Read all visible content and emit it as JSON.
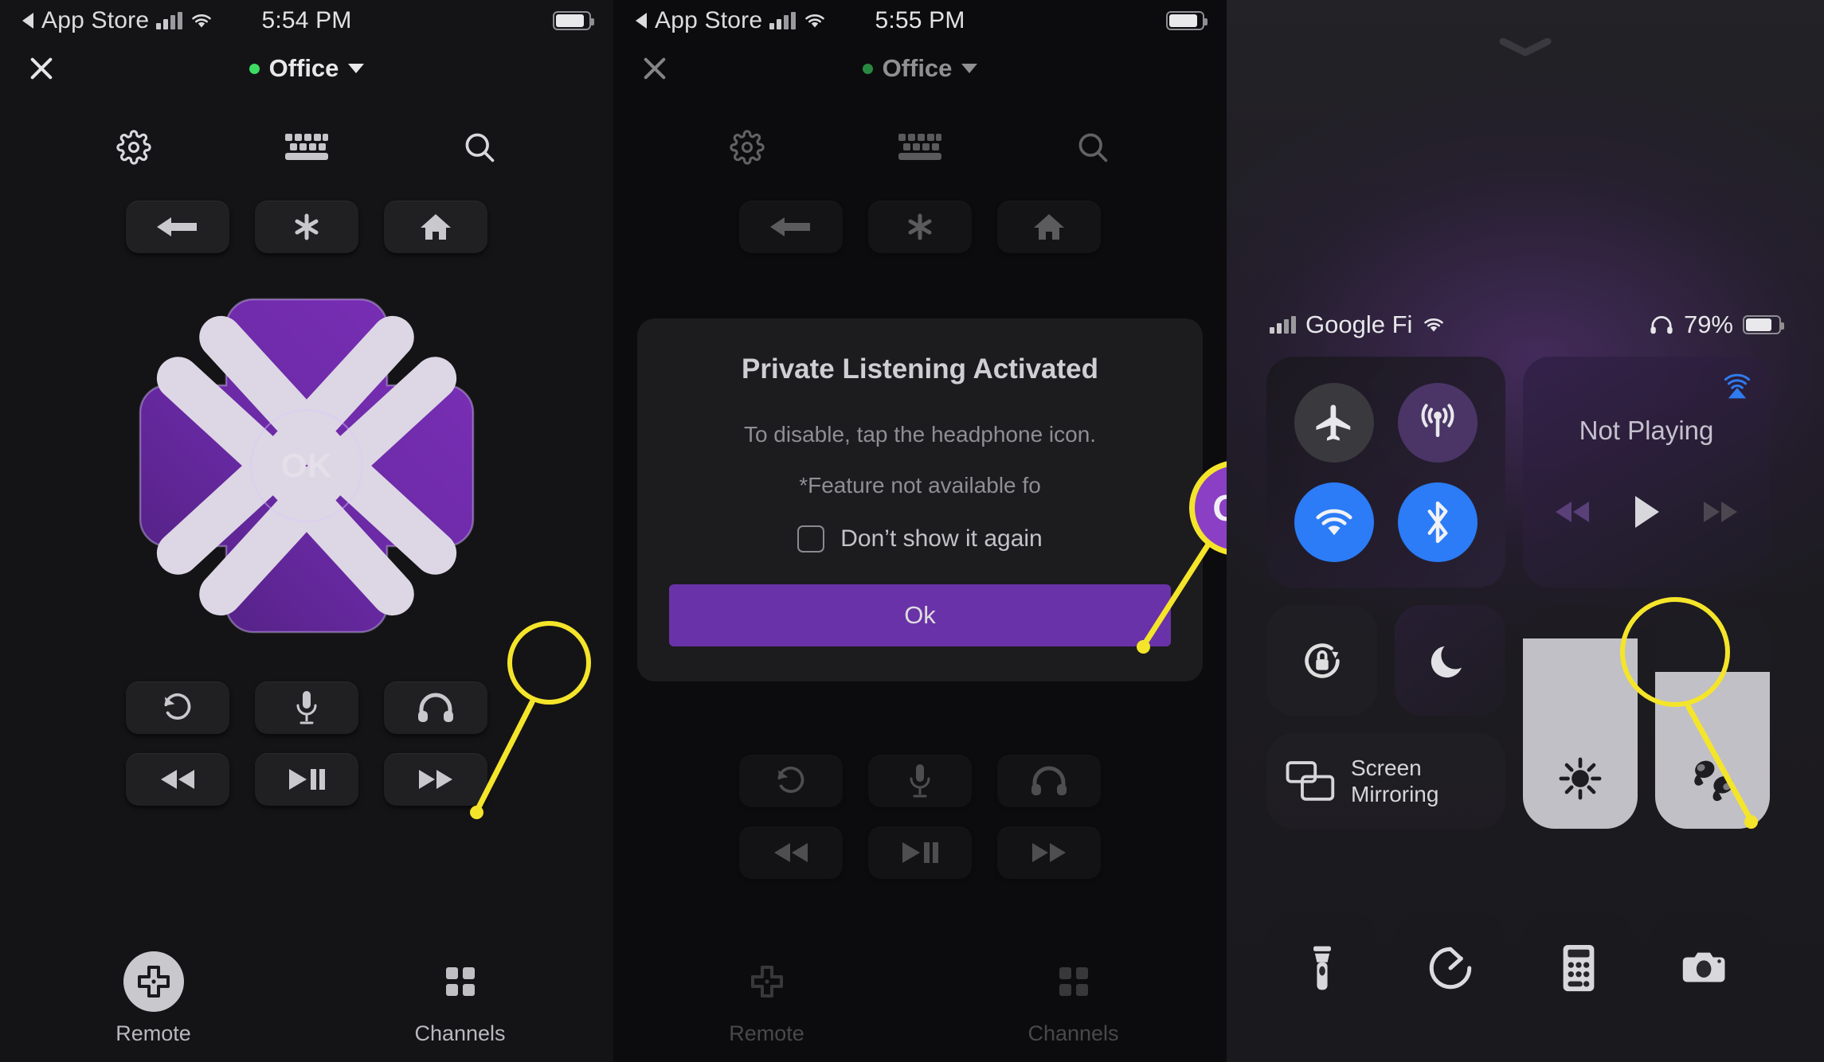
{
  "panel1": {
    "status": {
      "back_app": "App Store",
      "time": "5:54 PM",
      "signal": "signal-bars",
      "wifi": "wifi-icon"
    },
    "header": {
      "close": "close-icon",
      "device": "Office",
      "status_dot": "online"
    },
    "icon_row": [
      {
        "name": "settings-icon",
        "label": "Settings"
      },
      {
        "name": "keyboard-icon",
        "label": "Keyboard"
      },
      {
        "name": "search-icon",
        "label": "Search"
      }
    ],
    "nav": [
      {
        "name": "back-button",
        "label": "Back"
      },
      {
        "name": "options-button",
        "label": "Options"
      },
      {
        "name": "home-button",
        "label": "Home"
      }
    ],
    "dpad": {
      "ok": "OK",
      "up": "Up",
      "down": "Down",
      "left": "Left",
      "right": "Right"
    },
    "media": [
      {
        "name": "replay-button",
        "label": "Instant Replay"
      },
      {
        "name": "voice-button",
        "label": "Voice Search"
      },
      {
        "name": "headphones-button",
        "label": "Private Listening"
      },
      {
        "name": "rewind-button",
        "label": "Rewind"
      },
      {
        "name": "playpause-button",
        "label": "Play / Pause"
      },
      {
        "name": "fastforward-button",
        "label": "Fast Forward"
      }
    ],
    "tabs": [
      {
        "name": "tab-remote",
        "label": "Remote",
        "active": true
      },
      {
        "name": "tab-channels",
        "label": "Channels",
        "active": false
      }
    ]
  },
  "panel2": {
    "status": {
      "back_app": "App Store",
      "time": "5:55 PM"
    },
    "header": {
      "device": "Office"
    },
    "dialog": {
      "title": "Private Listening Activated",
      "line1": "To disable, tap the headphone icon.",
      "line2": "*Feature not available fo",
      "checkbox_label": "Don’t show it again",
      "ok_label": "Ok"
    }
  },
  "panel3": {
    "status": {
      "carrier": "Google Fi",
      "wifi": "wifi-icon",
      "headphone": "headphone-icon",
      "battery": "79%"
    },
    "connectivity": [
      {
        "name": "airplane-mode-toggle",
        "label": "Airplane Mode",
        "state": "off"
      },
      {
        "name": "cellular-data-toggle",
        "label": "Cellular Data",
        "state": "on"
      },
      {
        "name": "wifi-toggle",
        "label": "Wi-Fi",
        "state": "on"
      },
      {
        "name": "bluetooth-toggle",
        "label": "Bluetooth",
        "state": "on"
      }
    ],
    "now_playing": {
      "title": "Not Playing",
      "airplay": "airplay-icon",
      "controls": [
        {
          "name": "rewind-button",
          "label": "Rewind"
        },
        {
          "name": "play-button",
          "label": "Play"
        },
        {
          "name": "fastforward-button",
          "label": "Fast Forward"
        }
      ]
    },
    "toggles": [
      {
        "name": "rotation-lock-toggle",
        "label": "Rotation Lock"
      },
      {
        "name": "do-not-disturb-toggle",
        "label": "Do Not Disturb"
      }
    ],
    "screen_mirroring": {
      "label_line1": "Screen",
      "label_line2": "Mirroring"
    },
    "sliders": [
      {
        "name": "brightness-slider",
        "label": "Brightness",
        "value": 85
      },
      {
        "name": "volume-slider",
        "label": "Volume",
        "value": 70
      }
    ],
    "shortcuts": [
      {
        "name": "flashlight-button",
        "label": "Flashlight"
      },
      {
        "name": "timer-button",
        "label": "Timer"
      },
      {
        "name": "calculator-button",
        "label": "Calculator"
      },
      {
        "name": "camera-button",
        "label": "Camera"
      }
    ]
  },
  "annotations": {
    "highlight_color": "#f5e52a",
    "ok_bubble_label": "Ok"
  }
}
